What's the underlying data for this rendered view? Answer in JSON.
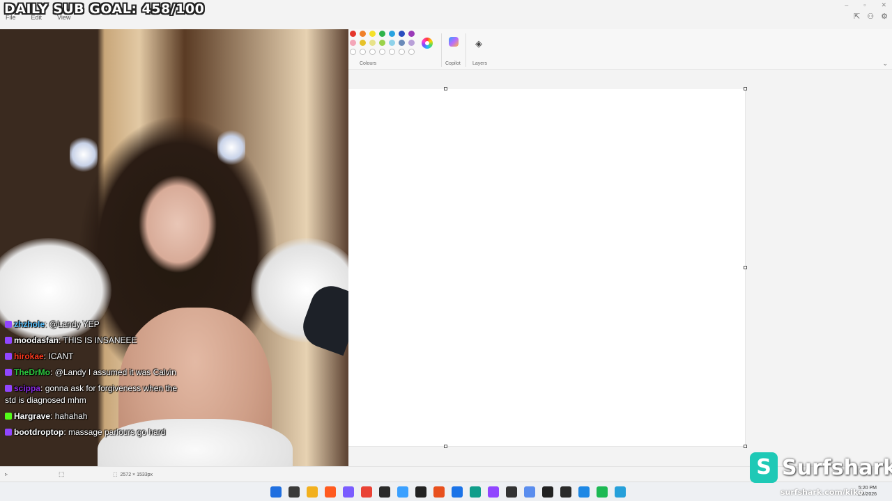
{
  "overlay": {
    "sub_goal": "DAILY SUB GOAL: 458/100"
  },
  "menu": {
    "items": [
      "File",
      "Edit",
      "View"
    ]
  },
  "ribbon": {
    "colours_label": "Colours",
    "copilot_label": "Copilot",
    "layers_label": "Layers",
    "swatch_colors": [
      "#e5352b",
      "#f0802a",
      "#f5e12a",
      "#2eb34a",
      "#2aa3e0",
      "#2a4dbf",
      "#9a3ab8",
      "#f4a6b8",
      "#e6c22a",
      "#e8e38a",
      "#9ad24a",
      "#8fd2ea",
      "#6a8ab8",
      "#b8a0d8"
    ]
  },
  "statusbar": {
    "canvas_size": "2572 × 1533px"
  },
  "chat": {
    "messages": [
      {
        "user": "zhzhole",
        "user_color": "#5bc3ff",
        "badge_color": "#9146ff",
        "text": "@Landy YEP"
      },
      {
        "user": "moodasfan",
        "user_color": "#ffffff",
        "badge_color": "#9146ff",
        "text": "THIS IS INSANEEE"
      },
      {
        "user": "hirokae",
        "user_color": "#ff3b1f",
        "badge_color": "#9146ff",
        "text": "ICANT"
      },
      {
        "user": "TheDrMo",
        "user_color": "#2ecc40",
        "badge_color": "#9146ff",
        "text": "@Landy I assumed it was Calvin"
      },
      {
        "user": "scippa",
        "user_color": "#8a2be2",
        "badge_color": "#9146ff",
        "text": "gonna ask for forgiveness when the std is diagnosed mhm"
      },
      {
        "user": "Hargrave",
        "user_color": "#ffffff",
        "badge_color": "#53fc18",
        "text": "hahahah"
      },
      {
        "user": "bootdroptop",
        "user_color": "#ffffff",
        "badge_color": "#9146ff",
        "text": "massage parlours go hard"
      }
    ]
  },
  "sponsor": {
    "logo_letter": "S",
    "name": "Surfshark",
    "url": "surfshark.com/kiko"
  },
  "taskbar": {
    "time": "5:20 PM",
    "date": "1/8/2026",
    "icon_colors": [
      "#1f6fe0",
      "#3a3a3a",
      "#f2b01e",
      "#ff5a1f",
      "#7a5cff",
      "#e94235",
      "#2a2a2a",
      "#3aa0ff",
      "#222222",
      "#e8501e",
      "#1a73e8",
      "#0f9d8a",
      "#9146ff",
      "#333333",
      "#5a8dee",
      "#222222",
      "#2a2a2a",
      "#1e88e5",
      "#1db954",
      "#26a0da"
    ]
  }
}
